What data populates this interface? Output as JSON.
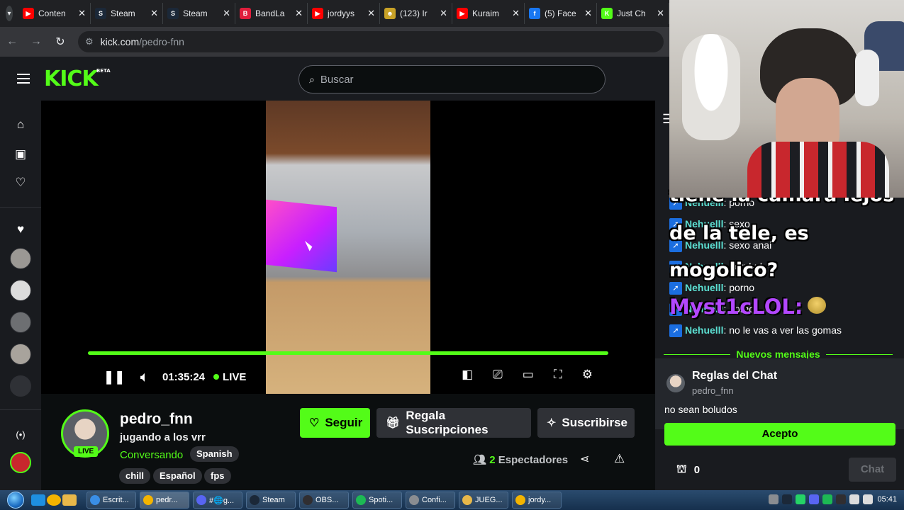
{
  "browser": {
    "tabs": [
      {
        "title": "Conten",
        "color": "#ff0000",
        "glyph": "▶"
      },
      {
        "title": "Steam",
        "color": "#1b2838",
        "glyph": "S"
      },
      {
        "title": "Steam",
        "color": "#1b2838",
        "glyph": "S"
      },
      {
        "title": "BandLa",
        "color": "#e01e3c",
        "glyph": "B"
      },
      {
        "title": "jordyys",
        "color": "#ff0000",
        "glyph": "▶"
      },
      {
        "title": "(123) Ir",
        "color": "#c9a227",
        "glyph": "☻"
      },
      {
        "title": "Kuraim",
        "color": "#ff0000",
        "glyph": "▶"
      },
      {
        "title": "(5) Face",
        "color": "#1877f2",
        "glyph": "f"
      },
      {
        "title": "Just Ch",
        "color": "#53fc18",
        "glyph": "K"
      }
    ],
    "url_host": "kick.com",
    "url_path": "/pedro-fnn"
  },
  "header": {
    "logo": "KICK",
    "logo_badge": "BETA",
    "search_placeholder": "Buscar"
  },
  "player": {
    "time": "01:35:24",
    "live_label": "LIVE",
    "progress": 1.0
  },
  "channel": {
    "name": "pedro_fnn",
    "title": "jugando a los vrr",
    "category": "Conversando",
    "language": "Spanish",
    "live_badge": "LIVE",
    "tags": [
      "chill",
      "Español",
      "fps"
    ],
    "follow_label": "Seguir",
    "gift_label": "Regala Suscripciones",
    "subscribe_label": "Suscribirse",
    "viewers_count": "2",
    "viewers_label": "Espectadores"
  },
  "chat": {
    "messages": [
      {
        "user": "Nehuelll",
        "text": ": porno"
      },
      {
        "user": "Nehuelll",
        "text": ": sexo"
      },
      {
        "user": "Nehuelll",
        "text": ": sexo anal"
      },
      {
        "user": "Nehuelll",
        "text": ": pornhub"
      },
      {
        "user": "Nehuelll",
        "text": ": porno"
      },
      {
        "user": "Nehuelll",
        "text": ": porno"
      },
      {
        "user": "Nehuelll",
        "text": ": no le vas a ver las gomas"
      }
    ],
    "overlay_lines": [
      "tiene la camara lejos",
      "de la tele, es",
      "mogolico?"
    ],
    "overlay_user": "Myst1cLOL:",
    "new_messages_label": "Nuevos mensajes",
    "rules_title": "Reglas del Chat",
    "rules_user": "pedro_fnn",
    "rules_text": "no sean boludos",
    "accept_label": "Acepto",
    "kicks_count": "0",
    "chat_button_label": "Chat"
  },
  "taskbar": {
    "items": [
      {
        "label": "Escrit...",
        "color": "#3a8ee6"
      },
      {
        "label": "pedr...",
        "color": "#f4b400"
      },
      {
        "label": "#🌐g...",
        "color": "#5865f2"
      },
      {
        "label": "Steam",
        "color": "#1b2838"
      },
      {
        "label": "OBS...",
        "color": "#302e31"
      },
      {
        "label": "Spoti...",
        "color": "#1db954"
      },
      {
        "label": "Confi...",
        "color": "#8a8d91"
      },
      {
        "label": "JUEG...",
        "color": "#e8b84a"
      },
      {
        "label": "jordy...",
        "color": "#f4b400"
      }
    ],
    "clock": "05:41"
  }
}
